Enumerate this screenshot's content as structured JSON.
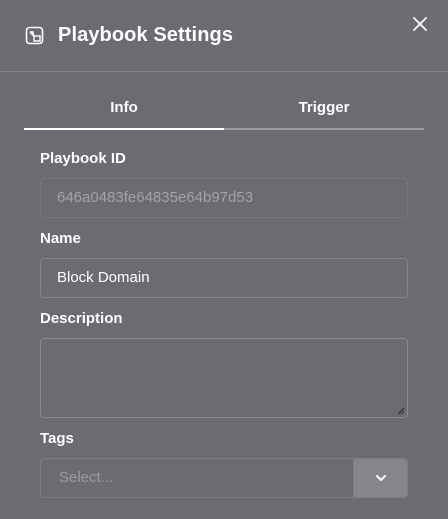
{
  "dialog": {
    "title": "Playbook Settings",
    "close_icon": "close-icon",
    "header_icon": "playbook-settings-icon"
  },
  "tabs": [
    {
      "label": "Info",
      "active": true
    },
    {
      "label": "Trigger",
      "active": false
    }
  ],
  "fields": {
    "playbook_id": {
      "label": "Playbook ID",
      "value": "646a0483fe64835e64b97d53"
    },
    "name": {
      "label": "Name",
      "value": "Block Domain"
    },
    "description": {
      "label": "Description",
      "value": ""
    },
    "tags": {
      "label": "Tags",
      "placeholder": "Select...",
      "toggle_icon": "chevron-down-icon"
    }
  },
  "colors": {
    "background": "#6b6b72",
    "text": "#ffffff",
    "muted_text": "#a2a2a8",
    "border": "#83838a",
    "select_toggle": "#85858b"
  }
}
